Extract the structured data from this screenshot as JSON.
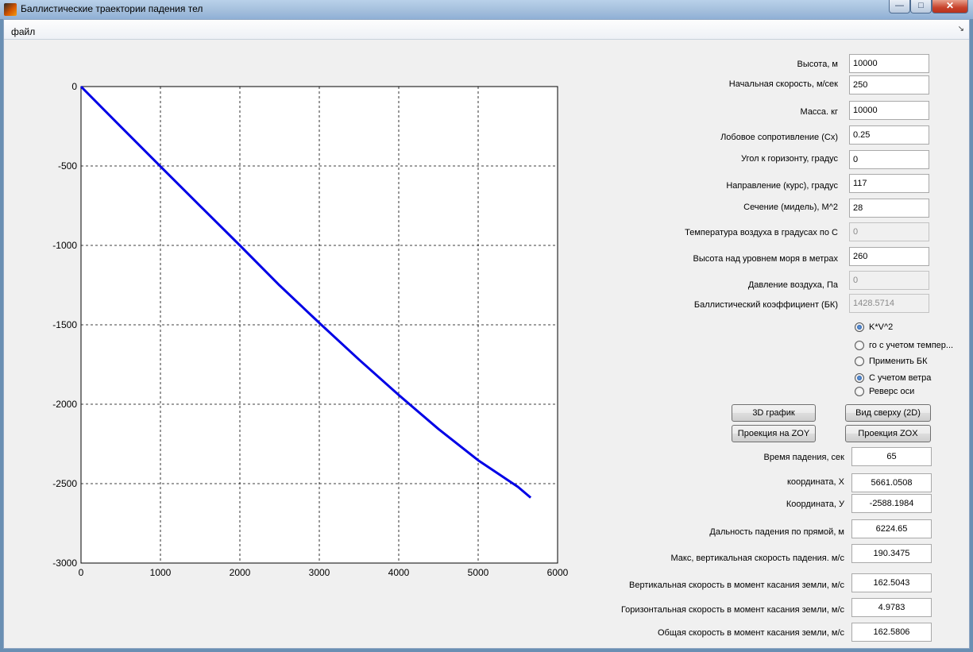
{
  "window": {
    "title": "Баллистические траектории падения тел"
  },
  "menu": {
    "file": "файл"
  },
  "plot": {
    "x_ticks": [
      "0",
      "1000",
      "2000",
      "3000",
      "4000",
      "5000",
      "6000"
    ],
    "y_ticks": [
      "0",
      "-500",
      "-1000",
      "-1500",
      "-2000",
      "-2500",
      "-3000"
    ],
    "line_color": "#0000e6"
  },
  "chart_data": {
    "type": "line",
    "xlim": [
      0,
      6000
    ],
    "ylim": [
      -3000,
      0
    ],
    "grid": true,
    "x": [
      0,
      500,
      1000,
      1500,
      2000,
      2500,
      3000,
      3500,
      4000,
      4500,
      5000,
      5500,
      5661
    ],
    "series": [
      {
        "values": [
          0,
          -252,
          -503,
          -752,
          -1000,
          -1252,
          -1488,
          -1719,
          -1942,
          -2156,
          -2353,
          -2520,
          -2588
        ]
      }
    ]
  },
  "form": {
    "fields": [
      {
        "label": "Высота, м",
        "value": "10000"
      },
      {
        "label": "Начальная скорость, м/сек",
        "value": "250"
      },
      {
        "label": "Масса. кг",
        "value": "10000"
      },
      {
        "label": "Лобовое сопротивление (Cx)",
        "value": "0.25"
      },
      {
        "label": "Угол к горизонту, градус",
        "value": "0"
      },
      {
        "label": "Направление  (курс), градус",
        "value": "117"
      },
      {
        "label": "Сечение (мидель), М^2",
        "value": "28"
      },
      {
        "label": "Температура воздуха в градусах по С",
        "value": "0"
      },
      {
        "label": "Высота над уровнем моря в метрах",
        "value": "260"
      },
      {
        "label": "Давление воздуха, Па",
        "value": "0"
      },
      {
        "label": "Баллистический коэффициент (БК)",
        "value": "1428.5714"
      }
    ],
    "radios": [
      {
        "label": "K*V^2"
      },
      {
        "label": "го с учетом темпер..."
      },
      {
        "label": "Применить БК"
      },
      {
        "label": "С учетом ветра"
      },
      {
        "label": "Реверс оси"
      }
    ],
    "buttons": {
      "graph3d": "3D график",
      "topview": "Вид сверху (2D)",
      "proj_zoy": "Проекция на ZOY",
      "proj_zox": "Проекция ZOX"
    },
    "results": [
      {
        "label": "Время падения, сек",
        "value": "65"
      },
      {
        "label": "координата, X",
        "value": "5661.0508"
      },
      {
        "label": "Координата, У",
        "value": "-2588.1984"
      },
      {
        "label": "Дальность падения по прямой, м",
        "value": "6224.65"
      },
      {
        "label": "Макс,  вертикальная скорость падения. м/с",
        "value": "190.3475"
      },
      {
        "label": "Вертикальная  скорость в момент касания земли, м/с",
        "value": "162.5043"
      },
      {
        "label": "Горизонтальная скорость в момент касания земли, м/с",
        "value": "4.9783"
      },
      {
        "label": "Общая скорость в момент касания земли, м/с",
        "value": "162.5806"
      }
    ]
  }
}
